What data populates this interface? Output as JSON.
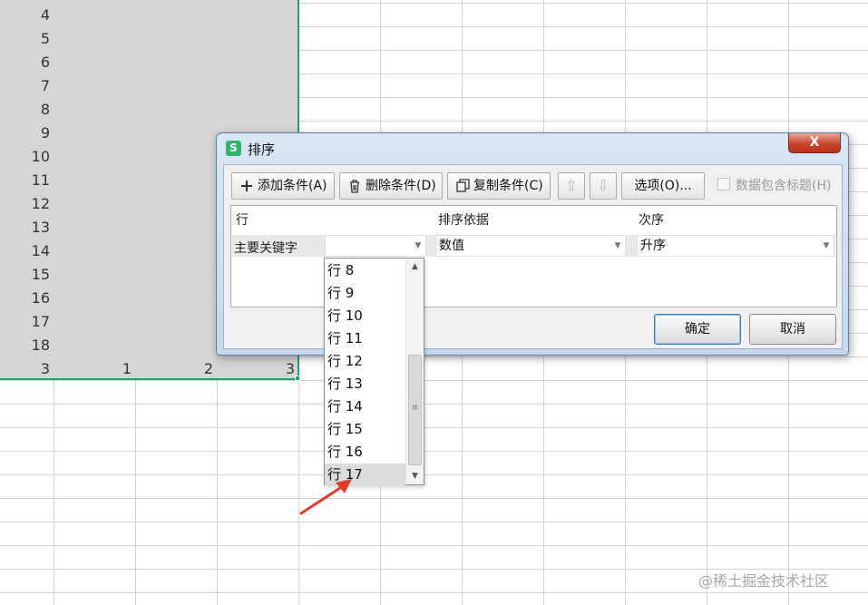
{
  "sheet": {
    "row_numbers": [
      "4",
      "5",
      "6",
      "7",
      "8",
      "9",
      "10",
      "11",
      "12",
      "13",
      "14",
      "15",
      "16",
      "17",
      "18"
    ],
    "bottom_row": [
      "3",
      "1",
      "2",
      "3"
    ],
    "selection_color": "#21a366"
  },
  "dialog": {
    "title": "排序",
    "app_icon": "S",
    "close_label": "X",
    "toolbar": {
      "add_label": "添加条件(A)",
      "delete_label": "删除条件(D)",
      "copy_label": "复制条件(C)",
      "move_up_icon": "⇧",
      "move_down_icon": "⇩",
      "options_label": "选项(O)...",
      "header_checkbox_label": "数据包含标题(H)",
      "header_checkbox_checked": false
    },
    "table": {
      "headers": [
        "行",
        "排序依据",
        "次序"
      ],
      "row": {
        "label": "主要关键字",
        "key_value": "",
        "basis_value": "数值",
        "order_value": "升序"
      }
    },
    "ok_label": "确定",
    "cancel_label": "取消"
  },
  "dropdown": {
    "items": [
      "行 8",
      "行 9",
      "行 10",
      "行 11",
      "行 12",
      "行 13",
      "行 14",
      "行 15",
      "行 16",
      "行 17"
    ],
    "highlighted": "行 17"
  },
  "watermark": "@稀土掘金技术社区",
  "annotation_color": "#e53a2a"
}
